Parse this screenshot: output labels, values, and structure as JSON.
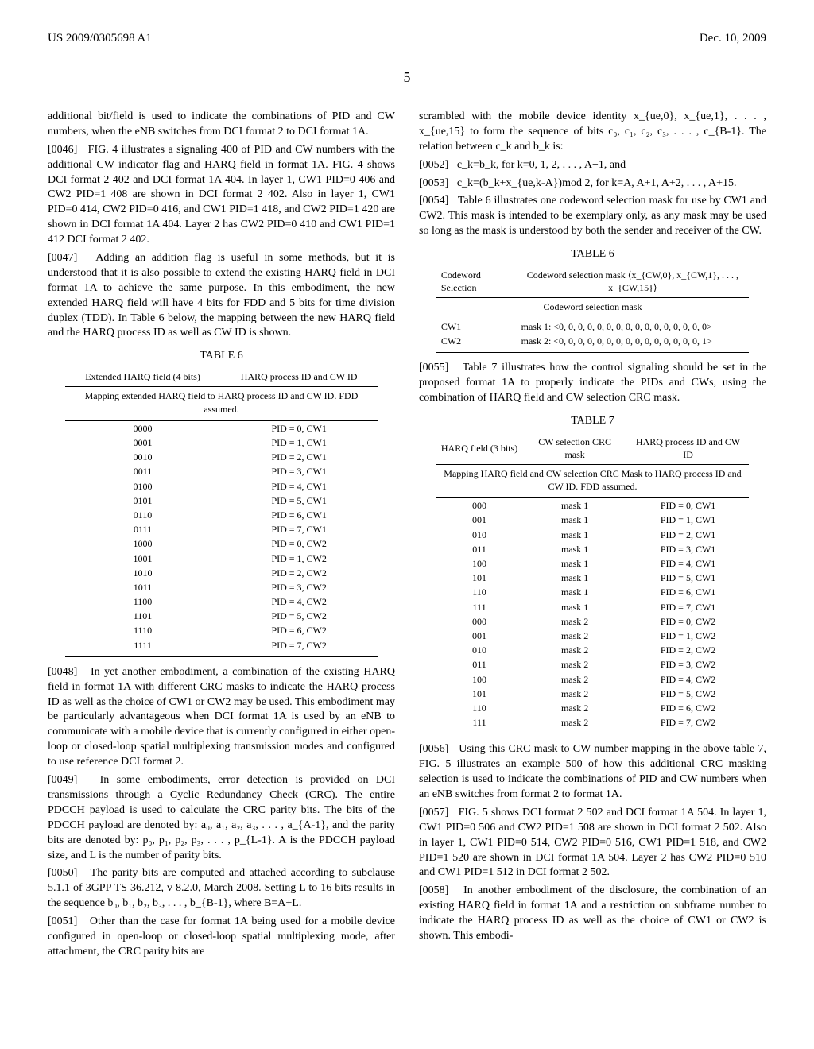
{
  "header": {
    "pub_number": "US 2009/0305698 A1",
    "date": "Dec. 10, 2009"
  },
  "page_number": "5",
  "left_column": {
    "intro_text": "additional bit/field is used to indicate the combinations of PID and CW numbers, when the eNB switches from DCI format 2 to DCI format 1A.",
    "p0046_label": "[0046]",
    "p0046": "FIG. 4 illustrates a signaling 400 of PID and CW numbers with the additional CW indicator flag and HARQ field in format 1A. FIG. 4 shows DCI format 2 402 and DCI format 1A 404. In layer 1, CW1 PID=0 406 and CW2 PID=1 408 are shown in DCI format 2 402. Also in layer 1, CW1 PID=0 414, CW2 PID=0 416, and CW1 PID=1 418, and CW2 PID=1 420 are shown in DCI format 1A 404. Layer 2 has CW2 PID=0 410 and CW1 PID=1 412 DCI format 2 402.",
    "p0047_label": "[0047]",
    "p0047": "Adding an addition flag is useful in some methods, but it is understood that it is also possible to extend the existing HARQ field in DCI format 1A to achieve the same purpose. In this embodiment, the new extended HARQ field will have 4 bits for FDD and 5 bits for time division duplex (TDD). In Table 6 below, the mapping between the new HARQ field and the HARQ process ID as well as CW ID is shown.",
    "table6_caption": "TABLE 6",
    "table6_title": "Mapping extended HARQ field to HARQ process ID and CW ID. FDD assumed.",
    "table6_headers": [
      "Extended HARQ field (4 bits)",
      "HARQ process ID and CW ID"
    ],
    "table6_rows": [
      [
        "0000",
        "PID = 0, CW1"
      ],
      [
        "0001",
        "PID = 1, CW1"
      ],
      [
        "0010",
        "PID = 2, CW1"
      ],
      [
        "0011",
        "PID = 3, CW1"
      ],
      [
        "0100",
        "PID = 4, CW1"
      ],
      [
        "0101",
        "PID = 5, CW1"
      ],
      [
        "0110",
        "PID = 6, CW1"
      ],
      [
        "0111",
        "PID = 7, CW1"
      ],
      [
        "1000",
        "PID = 0, CW2"
      ],
      [
        "1001",
        "PID = 1, CW2"
      ],
      [
        "1010",
        "PID = 2, CW2"
      ],
      [
        "1011",
        "PID = 3, CW2"
      ],
      [
        "1100",
        "PID = 4, CW2"
      ],
      [
        "1101",
        "PID = 5, CW2"
      ],
      [
        "1110",
        "PID = 6, CW2"
      ],
      [
        "1111",
        "PID = 7, CW2"
      ]
    ],
    "p0048_label": "[0048]",
    "p0048": "In yet another embodiment, a combination of the existing HARQ field in format 1A with different CRC masks to indicate the HARQ process ID as well as the choice of CW1 or CW2 may be used. This embodiment may be particularly advantageous when DCI format 1A is used by an eNB to communicate with a mobile device that is currently configured in either open-loop or closed-loop spatial multiplexing transmission modes and configured to use reference DCI format 2.",
    "p0049_label": "[0049]",
    "p0049": "In some embodiments, error detection is provided on DCI transmissions through a Cyclic Redundancy Check (CRC). The entire PDCCH payload is used to calculate the CRC parity bits. The bits of the PDCCH payload are denoted by: a₀, a₁, a₂, a₃, . . . , a_{A-1}, and the parity bits are denoted by: p₀, p₁, p₂, p₃, . . . , p_{L-1}. A is the PDCCH payload size, and L is the number of parity bits.",
    "p0050_label": "[0050]",
    "p0050": "The parity bits are computed and attached according to subclause 5.1.1 of 3GPP TS 36.212, v 8.2.0, March 2008. Setting L to 16 bits results in the sequence b₀, b₁, b₂, b₃, . . . , b_{B-1}, where B=A+L.",
    "p0051_label": "[0051]",
    "p0051": "Other than the case for format 1A being used for a mobile device configured in open-loop or closed-loop spatial multiplexing mode, after attachment, the CRC parity bits are"
  },
  "right_column": {
    "intro_text": "scrambled with the mobile device identity x_{ue,0}, x_{ue,1}, . . . , x_{ue,15} to form the sequence of bits c₀, c₁, c₂, c₃, . . . , c_{B-1}. The relation between c_k and b_k is:",
    "p0052_label": "[0052]",
    "p0052": "c_k=b_k, for k=0, 1, 2, . . . , A−1, and",
    "p0053_label": "[0053]",
    "p0053": "c_k=(b_k+x_{ue,k-A})mod 2, for k=A, A+1, A+2, . . . , A+15.",
    "p0054_label": "[0054]",
    "p0054": "Table 6 illustrates one codeword selection mask for use by CW1 and CW2. This mask is intended to be exemplary only, as any mask may be used so long as the mask is understood by both the sender and receiver of the CW.",
    "table6b_caption": "TABLE 6",
    "table6b_title": "Codeword selection mask",
    "table6b_headers": [
      "Codeword Selection",
      "Codeword selection mask ⟨x_{CW,0}, x_{CW,1}, . . . , x_{CW,15}⟩"
    ],
    "table6b_rows": [
      [
        "CW1",
        "mask 1: <0, 0, 0, 0, 0, 0, 0, 0, 0, 0, 0, 0, 0, 0, 0, 0>"
      ],
      [
        "CW2",
        "mask 2: <0, 0, 0, 0, 0, 0, 0, 0, 0, 0, 0, 0, 0, 0, 0, 1>"
      ]
    ],
    "p0055_label": "[0055]",
    "p0055": "Table 7 illustrates how the control signaling should be set in the proposed format 1A to properly indicate the PIDs and CWs, using the combination of HARQ field and CW selection CRC mask.",
    "table7_caption": "TABLE 7",
    "table7_title": "Mapping HARQ field and CW selection CRC Mask to HARQ process ID and CW ID. FDD assumed.",
    "table7_headers": [
      "HARQ field (3 bits)",
      "CW selection CRC mask",
      "HARQ process ID and CW ID"
    ],
    "table7_rows": [
      [
        "000",
        "mask 1",
        "PID = 0, CW1"
      ],
      [
        "001",
        "mask 1",
        "PID = 1, CW1"
      ],
      [
        "010",
        "mask 1",
        "PID = 2, CW1"
      ],
      [
        "011",
        "mask 1",
        "PID = 3, CW1"
      ],
      [
        "100",
        "mask 1",
        "PID = 4, CW1"
      ],
      [
        "101",
        "mask 1",
        "PID = 5, CW1"
      ],
      [
        "110",
        "mask 1",
        "PID = 6, CW1"
      ],
      [
        "111",
        "mask 1",
        "PID = 7, CW1"
      ],
      [
        "000",
        "mask 2",
        "PID = 0, CW2"
      ],
      [
        "001",
        "mask 2",
        "PID = 1, CW2"
      ],
      [
        "010",
        "mask 2",
        "PID = 2, CW2"
      ],
      [
        "011",
        "mask 2",
        "PID = 3, CW2"
      ],
      [
        "100",
        "mask 2",
        "PID = 4, CW2"
      ],
      [
        "101",
        "mask 2",
        "PID = 5, CW2"
      ],
      [
        "110",
        "mask 2",
        "PID = 6, CW2"
      ],
      [
        "111",
        "mask 2",
        "PID = 7, CW2"
      ]
    ],
    "p0056_label": "[0056]",
    "p0056": "Using this CRC mask to CW number mapping in the above table 7, FIG. 5 illustrates an example 500 of how this additional CRC masking selection is used to indicate the combinations of PID and CW numbers when an eNB switches from format 2 to format 1A.",
    "p0057_label": "[0057]",
    "p0057": "FIG. 5 shows DCI format 2 502 and DCI format 1A 504. In layer 1, CW1 PID=0 506 and CW2 PID=1 508 are shown in DCI format 2 502. Also in layer 1, CW1 PID=0 514, CW2 PID=0 516, CW1 PID=1 518, and CW2 PID=1 520 are shown in DCI format 1A 504. Layer 2 has CW2 PID=0 510 and CW1 PID=1 512 in DCI format 2 502.",
    "p0058_label": "[0058]",
    "p0058": "In another embodiment of the disclosure, the combination of an existing HARQ field in format 1A and a restriction on subframe number to indicate the HARQ process ID as well as the choice of CW1 or CW2 is shown. This embodi-"
  }
}
